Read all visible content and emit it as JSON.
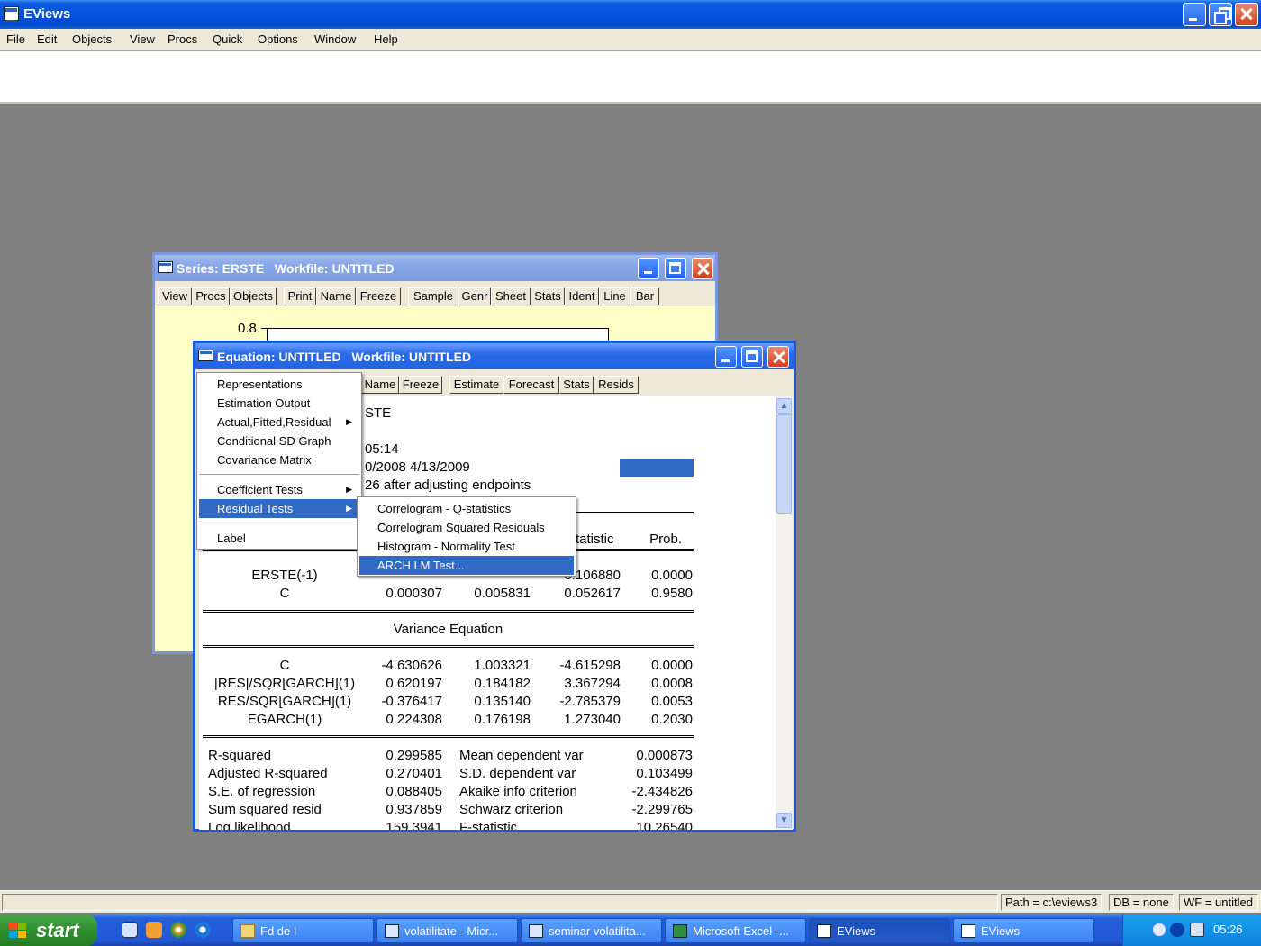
{
  "app": {
    "title": "EViews"
  },
  "menubar": [
    "File",
    "Edit",
    "Objects",
    "View",
    "Procs",
    "Quick",
    "Options",
    "Window",
    "Help"
  ],
  "series_window": {
    "title": "Series: ERSTE   Workfile: UNTITLED",
    "toolbar": [
      "View",
      "Procs",
      "Objects",
      "Print",
      "Name",
      "Freeze",
      "Sample",
      "Genr",
      "Sheet",
      "Stats",
      "Ident",
      "Line",
      "Bar"
    ],
    "y_tick": "0.8"
  },
  "equation_window": {
    "title": "Equation: UNTITLED   Workfile: UNTITLED",
    "toolbar": [
      "Name",
      "Freeze",
      "Estimate",
      "Forecast",
      "Stats",
      "Resids"
    ],
    "partial_lines": [
      "STE",
      "05:14",
      "0/2008 4/13/2009",
      "26 after adjusting endpoints",
      "tatistic"
    ],
    "prob_header": "Prob.",
    "mean_rows": [
      {
        "name": "ERSTE(-1)",
        "c4": "0.106880",
        "c5": "0.0000"
      },
      {
        "name": "C",
        "c2": "0.000307",
        "c3": "0.005831",
        "c4": "0.052617",
        "c5": "0.9580"
      }
    ],
    "variance_title": "Variance Equation",
    "variance_rows": [
      {
        "name": "C",
        "c2": "-4.630626",
        "c3": "1.003321",
        "c4": "-4.615298",
        "c5": "0.0000"
      },
      {
        "name": "|RES|/SQR[GARCH](1)",
        "c2": "0.620197",
        "c3": "0.184182",
        "c4": "3.367294",
        "c5": "0.0008"
      },
      {
        "name": "RES/SQR[GARCH](1)",
        "c2": "-0.376417",
        "c3": "0.135140",
        "c4": "-2.785379",
        "c5": "0.0053"
      },
      {
        "name": "EGARCH(1)",
        "c2": "0.224308",
        "c3": "0.176198",
        "c4": "1.273040",
        "c5": "0.2030"
      }
    ],
    "stats_rows": [
      {
        "l": "R-squared",
        "lv": "0.299585",
        "r": "Mean dependent var",
        "rv": "0.000873"
      },
      {
        "l": "Adjusted R-squared",
        "lv": "0.270401",
        "r": "S.D. dependent var",
        "rv": "0.103499"
      },
      {
        "l": "S.E. of regression",
        "lv": "0.088405",
        "r": "Akaike info criterion",
        "rv": "-2.434826"
      },
      {
        "l": "Sum squared resid",
        "lv": "0.937859",
        "r": "Schwarz criterion",
        "rv": "-2.299765"
      },
      {
        "l": "Log likelihood",
        "lv": "159.3941",
        "r": "F-statistic",
        "rv": "10.26540"
      }
    ]
  },
  "view_menu": {
    "items": [
      "Representations",
      "Estimation Output",
      "Actual,Fitted,Residual",
      "Conditional SD Graph",
      "Covariance Matrix",
      "Coefficient Tests",
      "Residual Tests",
      "Label"
    ],
    "selected": "Residual Tests"
  },
  "residual_submenu": {
    "items": [
      "Correlogram - Q-statistics",
      "Correlogram Squared Residuals",
      "Histogram - Normality Test",
      "ARCH LM Test..."
    ],
    "selected": "ARCH LM Test..."
  },
  "statusbar": {
    "path": "Path = c:\\eviews3",
    "db": "DB = none",
    "wf": "WF = untitled"
  },
  "taskbar": {
    "start": "start",
    "tasks": [
      "Fd de I",
      "volatilitate - Micr...",
      "seminar volatilita...",
      "Microsoft Excel -...",
      "EViews",
      "EViews"
    ],
    "clock": "05:26"
  }
}
